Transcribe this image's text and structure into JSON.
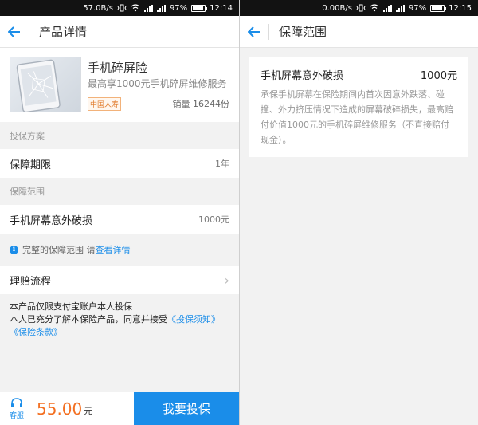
{
  "left": {
    "status": {
      "speed": "57.0B/s",
      "battery": "97%",
      "time": "12:14"
    },
    "nav": {
      "title": "产品详情"
    },
    "product": {
      "title": "手机碎屏险",
      "subtitle": "最高享1000元手机碎屏维修服务",
      "badge": "中国人寿",
      "sales": "销量 16244份"
    },
    "plan_section": "投保方案",
    "period": {
      "label": "保障期限",
      "value": "1年"
    },
    "coverage_section": "保障范围",
    "coverage": {
      "label": "手机屏幕意外破损",
      "value": "1000元"
    },
    "full_coverage": {
      "text": "完整的保障范围 请",
      "link": "查看详情"
    },
    "claims": {
      "label": "理赔流程"
    },
    "note": {
      "line1": "本产品仅限支付宝账户本人投保",
      "line2": "本人已充分了解本保险产品，同意并接受",
      "link1": "《投保须知》",
      "link2": "《保险条款》"
    },
    "bottom": {
      "cs_label": "客服",
      "price": "55.00",
      "unit": "元",
      "buy": "我要投保"
    }
  },
  "right": {
    "status": {
      "speed": "0.00B/s",
      "battery": "97%",
      "time": "12:15"
    },
    "nav": {
      "title": "保障范围"
    },
    "card": {
      "title": "手机屏幕意外破损",
      "amount": "1000元",
      "desc": "承保手机屏幕在保险期间内首次因意外跌落、碰撞、外力挤压情况下造成的屏幕破碎损失，最高赔付价值1000元的手机碎屏维修服务（不直接赔付现金）。"
    }
  },
  "colors": {
    "accent": "#1a8de9",
    "price": "#f36f21",
    "badge": "#e07a2a"
  },
  "icons": [
    "back-arrow-icon",
    "wifi-icon",
    "signal-icon",
    "battery-icon",
    "chevron-right-icon",
    "info-icon",
    "headset-icon"
  ]
}
